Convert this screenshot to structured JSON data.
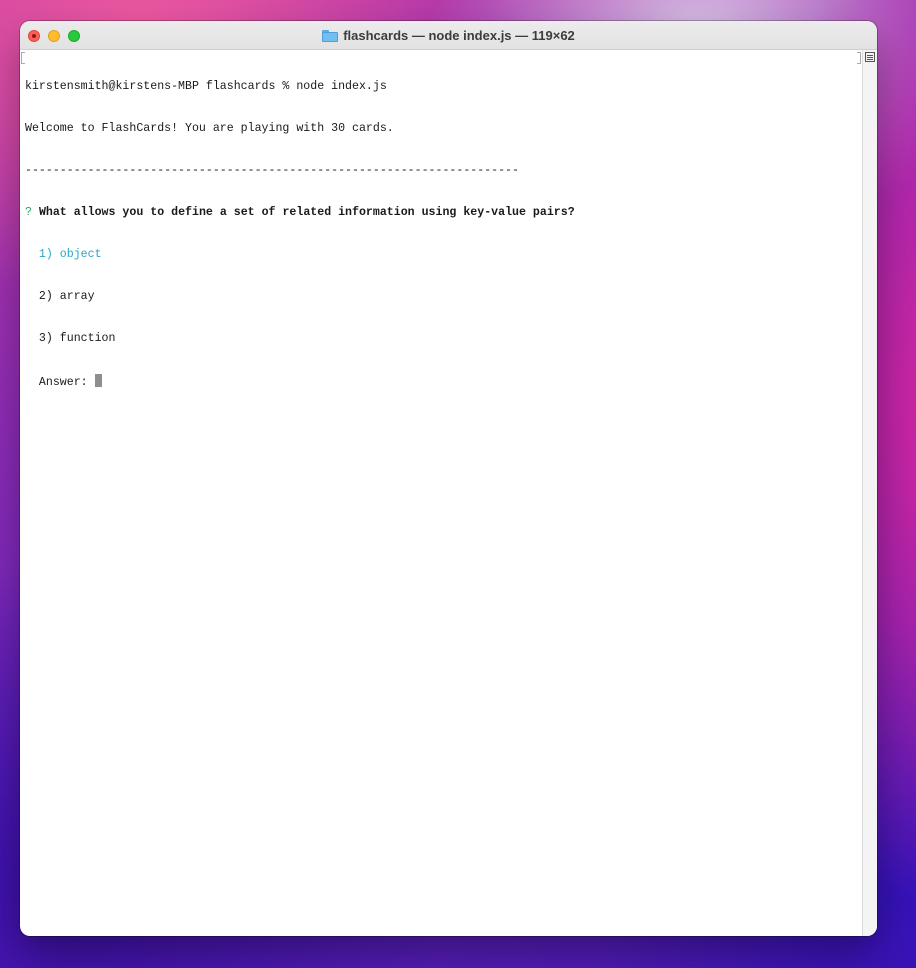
{
  "window": {
    "title": "flashcards — node index.js — 119×62"
  },
  "icons": {
    "title_icon": "folder-icon",
    "scroll_marker": "bookmark-icon"
  },
  "colors": {
    "traffic_close": "#fe5f57",
    "traffic_minimize": "#febc2e",
    "traffic_maximize": "#28c840",
    "prompt_question_mark": "#2aa06a",
    "selected_choice": "#2aa8c2"
  },
  "terminal": {
    "command_line": "kirstensmith@kirstens-MBP flashcards % node index.js",
    "welcome": "Welcome to FlashCards! You are playing with 30 cards.",
    "divider": "-----------------------------------------------------------------------",
    "question_mark": "?",
    "question": "What allows you to define a set of related information using key-value pairs?",
    "choices": [
      "1) object",
      "2) array",
      "3) function"
    ],
    "answer_label": "Answer:"
  }
}
